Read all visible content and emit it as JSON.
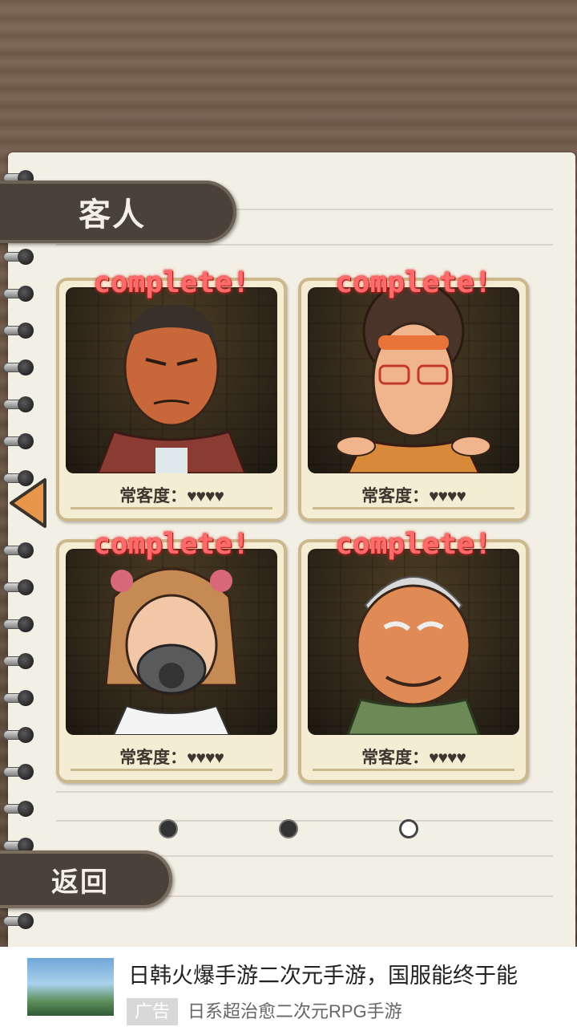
{
  "header": {
    "title": "客人"
  },
  "cards": [
    {
      "status": "complete!",
      "label": "常客度：",
      "hearts": "♥♥♥♥"
    },
    {
      "status": "complete!",
      "label": "常客度：",
      "hearts": "♥♥♥♥"
    },
    {
      "status": "complete!",
      "label": "常客度：",
      "hearts": "♥♥♥♥"
    },
    {
      "status": "complete!",
      "label": "常客度：",
      "hearts": "♥♥♥♥"
    }
  ],
  "nav": {
    "prev_icon": "left-arrow-icon"
  },
  "pager": {
    "current_page": 3,
    "total_pages": 3
  },
  "footer": {
    "back_label": "返回"
  },
  "ad": {
    "title": "日韩火爆手游二次元手游，国服能终于能",
    "tag": "广告",
    "subtitle": "日系超治愈二次元RPG手游"
  },
  "colors": {
    "tab": "#4a4239",
    "paper": "#f2efe4",
    "accent_arrow": "#e8974a",
    "complete_text": "#ff6a6a"
  }
}
